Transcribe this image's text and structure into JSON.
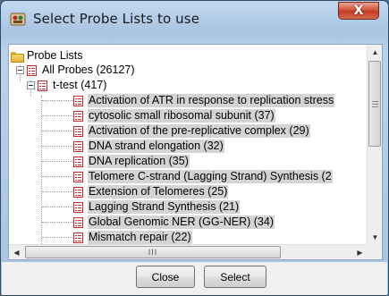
{
  "window": {
    "title": "Select Probe Lists to use",
    "close_glyph": "X"
  },
  "tree": {
    "root_label": "Probe Lists",
    "all_probes_label": "All Probes (26127)",
    "ttest_label": "t-test (417)",
    "items": [
      "Activation of ATR in response to replication stress",
      "cytosolic small ribosomal subunit (37)",
      "Activation of the pre-replicative complex (29)",
      "DNA strand elongation (32)",
      "DNA replication (35)",
      "Telomere C-strand (Lagging Strand) Synthesis (2",
      "Extension of Telomeres (25)",
      "Lagging Strand Synthesis (21)",
      "Global Genomic NER (GG-NER) (34)",
      "Mismatch repair (22)"
    ]
  },
  "scrollbars": {
    "up_arrow": "▲",
    "down_arrow": "▼",
    "left_arrow": "◀",
    "right_arrow": "▶",
    "h_thumb_grip": "III"
  },
  "buttons": {
    "close_label": "Close",
    "select_label": "Select"
  },
  "colors": {
    "list_icon_red": "#c42a2a",
    "highlight": "#d4d4d4",
    "close_button_red": "#c23c22"
  }
}
